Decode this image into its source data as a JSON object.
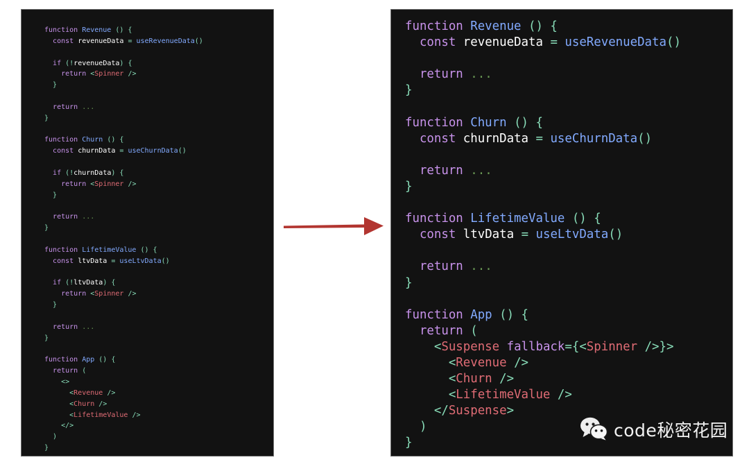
{
  "meta": {
    "background_color": "#ffffff",
    "panel_background": "#121212",
    "panel_border_color": "#6f6f6f",
    "arrow_color": "#b23530"
  },
  "palette": {
    "keyword": "#c792ea",
    "function_name": "#82aaff",
    "variable": "#ffffff",
    "punctuation": "#89ddb9",
    "component": "#e06c75",
    "ellipsis": "#6a9955"
  },
  "panels": {
    "before": {
      "name": "before-code-panel",
      "lines": [
        [
          {
            "t": "function ",
            "c": "kw"
          },
          {
            "t": "Revenue",
            "c": "fn"
          },
          {
            "t": " () {",
            "c": "punct"
          }
        ],
        [
          {
            "t": "  ",
            "c": "plain"
          },
          {
            "t": "const",
            "c": "kw"
          },
          {
            "t": " ",
            "c": "plain"
          },
          {
            "t": "revenueData",
            "c": "var"
          },
          {
            "t": " = ",
            "c": "punct"
          },
          {
            "t": "useRevenueData",
            "c": "fn"
          },
          {
            "t": "()",
            "c": "punct"
          }
        ],
        [],
        [
          {
            "t": "  ",
            "c": "plain"
          },
          {
            "t": "if",
            "c": "kw"
          },
          {
            "t": " (",
            "c": "punct"
          },
          {
            "t": "!",
            "c": "punct"
          },
          {
            "t": "revenueData",
            "c": "var"
          },
          {
            "t": ") {",
            "c": "punct"
          }
        ],
        [
          {
            "t": "    ",
            "c": "plain"
          },
          {
            "t": "return",
            "c": "kw"
          },
          {
            "t": " ",
            "c": "plain"
          },
          {
            "t": "<",
            "c": "punct"
          },
          {
            "t": "Spinner",
            "c": "comp"
          },
          {
            "t": " />",
            "c": "punct"
          }
        ],
        [
          {
            "t": "  }",
            "c": "punct"
          }
        ],
        [],
        [
          {
            "t": "  ",
            "c": "plain"
          },
          {
            "t": "return",
            "c": "kw"
          },
          {
            "t": " ",
            "c": "plain"
          },
          {
            "t": "...",
            "c": "dots"
          }
        ],
        [
          {
            "t": "}",
            "c": "punct"
          }
        ],
        [],
        [
          {
            "t": "function ",
            "c": "kw"
          },
          {
            "t": "Churn",
            "c": "fn"
          },
          {
            "t": " () {",
            "c": "punct"
          }
        ],
        [
          {
            "t": "  ",
            "c": "plain"
          },
          {
            "t": "const",
            "c": "kw"
          },
          {
            "t": " ",
            "c": "plain"
          },
          {
            "t": "churnData",
            "c": "var"
          },
          {
            "t": " = ",
            "c": "punct"
          },
          {
            "t": "useChurnData",
            "c": "fn"
          },
          {
            "t": "()",
            "c": "punct"
          }
        ],
        [],
        [
          {
            "t": "  ",
            "c": "plain"
          },
          {
            "t": "if",
            "c": "kw"
          },
          {
            "t": " (",
            "c": "punct"
          },
          {
            "t": "!",
            "c": "punct"
          },
          {
            "t": "churnData",
            "c": "var"
          },
          {
            "t": ") {",
            "c": "punct"
          }
        ],
        [
          {
            "t": "    ",
            "c": "plain"
          },
          {
            "t": "return",
            "c": "kw"
          },
          {
            "t": " ",
            "c": "plain"
          },
          {
            "t": "<",
            "c": "punct"
          },
          {
            "t": "Spinner",
            "c": "comp"
          },
          {
            "t": " />",
            "c": "punct"
          }
        ],
        [
          {
            "t": "  }",
            "c": "punct"
          }
        ],
        [],
        [
          {
            "t": "  ",
            "c": "plain"
          },
          {
            "t": "return",
            "c": "kw"
          },
          {
            "t": " ",
            "c": "plain"
          },
          {
            "t": "...",
            "c": "dots"
          }
        ],
        [
          {
            "t": "}",
            "c": "punct"
          }
        ],
        [],
        [
          {
            "t": "function ",
            "c": "kw"
          },
          {
            "t": "LifetimeValue",
            "c": "fn"
          },
          {
            "t": " () {",
            "c": "punct"
          }
        ],
        [
          {
            "t": "  ",
            "c": "plain"
          },
          {
            "t": "const",
            "c": "kw"
          },
          {
            "t": " ",
            "c": "plain"
          },
          {
            "t": "ltvData",
            "c": "var"
          },
          {
            "t": " = ",
            "c": "punct"
          },
          {
            "t": "useLtvData",
            "c": "fn"
          },
          {
            "t": "()",
            "c": "punct"
          }
        ],
        [],
        [
          {
            "t": "  ",
            "c": "plain"
          },
          {
            "t": "if",
            "c": "kw"
          },
          {
            "t": " (",
            "c": "punct"
          },
          {
            "t": "!",
            "c": "punct"
          },
          {
            "t": "ltvData",
            "c": "var"
          },
          {
            "t": ") {",
            "c": "punct"
          }
        ],
        [
          {
            "t": "    ",
            "c": "plain"
          },
          {
            "t": "return",
            "c": "kw"
          },
          {
            "t": " ",
            "c": "plain"
          },
          {
            "t": "<",
            "c": "punct"
          },
          {
            "t": "Spinner",
            "c": "comp"
          },
          {
            "t": " />",
            "c": "punct"
          }
        ],
        [
          {
            "t": "  }",
            "c": "punct"
          }
        ],
        [],
        [
          {
            "t": "  ",
            "c": "plain"
          },
          {
            "t": "return",
            "c": "kw"
          },
          {
            "t": " ",
            "c": "plain"
          },
          {
            "t": "...",
            "c": "dots"
          }
        ],
        [
          {
            "t": "}",
            "c": "punct"
          }
        ],
        [],
        [
          {
            "t": "function ",
            "c": "kw"
          },
          {
            "t": "App",
            "c": "fn"
          },
          {
            "t": " () {",
            "c": "punct"
          }
        ],
        [
          {
            "t": "  ",
            "c": "plain"
          },
          {
            "t": "return",
            "c": "kw"
          },
          {
            "t": " (",
            "c": "punct"
          }
        ],
        [
          {
            "t": "    <>",
            "c": "punct"
          }
        ],
        [
          {
            "t": "      <",
            "c": "punct"
          },
          {
            "t": "Revenue",
            "c": "comp"
          },
          {
            "t": " />",
            "c": "punct"
          }
        ],
        [
          {
            "t": "      <",
            "c": "punct"
          },
          {
            "t": "Churn",
            "c": "comp"
          },
          {
            "t": " />",
            "c": "punct"
          }
        ],
        [
          {
            "t": "      <",
            "c": "punct"
          },
          {
            "t": "LifetimeValue",
            "c": "comp"
          },
          {
            "t": " />",
            "c": "punct"
          }
        ],
        [
          {
            "t": "    </>",
            "c": "punct"
          }
        ],
        [
          {
            "t": "  )",
            "c": "punct"
          }
        ],
        [
          {
            "t": "}",
            "c": "punct"
          }
        ]
      ]
    },
    "after": {
      "name": "after-code-panel",
      "lines": [
        [
          {
            "t": "function ",
            "c": "kw"
          },
          {
            "t": "Revenue",
            "c": "fn"
          },
          {
            "t": " () {",
            "c": "punct"
          }
        ],
        [
          {
            "t": "  ",
            "c": "plain"
          },
          {
            "t": "const",
            "c": "kw"
          },
          {
            "t": " ",
            "c": "plain"
          },
          {
            "t": "revenueData",
            "c": "var"
          },
          {
            "t": " = ",
            "c": "punct"
          },
          {
            "t": "useRevenueData",
            "c": "fn"
          },
          {
            "t": "()",
            "c": "punct"
          }
        ],
        [],
        [
          {
            "t": "  ",
            "c": "plain"
          },
          {
            "t": "return",
            "c": "kw"
          },
          {
            "t": " ",
            "c": "plain"
          },
          {
            "t": "...",
            "c": "dots"
          }
        ],
        [
          {
            "t": "}",
            "c": "punct"
          }
        ],
        [],
        [
          {
            "t": "function ",
            "c": "kw"
          },
          {
            "t": "Churn",
            "c": "fn"
          },
          {
            "t": " () {",
            "c": "punct"
          }
        ],
        [
          {
            "t": "  ",
            "c": "plain"
          },
          {
            "t": "const",
            "c": "kw"
          },
          {
            "t": " ",
            "c": "plain"
          },
          {
            "t": "churnData",
            "c": "var"
          },
          {
            "t": " = ",
            "c": "punct"
          },
          {
            "t": "useChurnData",
            "c": "fn"
          },
          {
            "t": "()",
            "c": "punct"
          }
        ],
        [],
        [
          {
            "t": "  ",
            "c": "plain"
          },
          {
            "t": "return",
            "c": "kw"
          },
          {
            "t": " ",
            "c": "plain"
          },
          {
            "t": "...",
            "c": "dots"
          }
        ],
        [
          {
            "t": "}",
            "c": "punct"
          }
        ],
        [],
        [
          {
            "t": "function ",
            "c": "kw"
          },
          {
            "t": "LifetimeValue",
            "c": "fn"
          },
          {
            "t": " () {",
            "c": "punct"
          }
        ],
        [
          {
            "t": "  ",
            "c": "plain"
          },
          {
            "t": "const",
            "c": "kw"
          },
          {
            "t": " ",
            "c": "plain"
          },
          {
            "t": "ltvData",
            "c": "var"
          },
          {
            "t": " = ",
            "c": "punct"
          },
          {
            "t": "useLtvData",
            "c": "fn"
          },
          {
            "t": "()",
            "c": "punct"
          }
        ],
        [],
        [
          {
            "t": "  ",
            "c": "plain"
          },
          {
            "t": "return",
            "c": "kw"
          },
          {
            "t": " ",
            "c": "plain"
          },
          {
            "t": "...",
            "c": "dots"
          }
        ],
        [
          {
            "t": "}",
            "c": "punct"
          }
        ],
        [],
        [
          {
            "t": "function ",
            "c": "kw"
          },
          {
            "t": "App",
            "c": "fn"
          },
          {
            "t": " () {",
            "c": "punct"
          }
        ],
        [
          {
            "t": "  ",
            "c": "plain"
          },
          {
            "t": "return",
            "c": "kw"
          },
          {
            "t": " (",
            "c": "punct"
          }
        ],
        [
          {
            "t": "    <",
            "c": "punct"
          },
          {
            "t": "Suspense",
            "c": "comp"
          },
          {
            "t": " ",
            "c": "plain"
          },
          {
            "t": "fallback",
            "c": "attr"
          },
          {
            "t": "={<",
            "c": "punct"
          },
          {
            "t": "Spinner",
            "c": "comp"
          },
          {
            "t": " />}>",
            "c": "punct"
          }
        ],
        [
          {
            "t": "      <",
            "c": "punct"
          },
          {
            "t": "Revenue",
            "c": "comp"
          },
          {
            "t": " />",
            "c": "punct"
          }
        ],
        [
          {
            "t": "      <",
            "c": "punct"
          },
          {
            "t": "Churn",
            "c": "comp"
          },
          {
            "t": " />",
            "c": "punct"
          }
        ],
        [
          {
            "t": "      <",
            "c": "punct"
          },
          {
            "t": "LifetimeValue",
            "c": "comp"
          },
          {
            "t": " />",
            "c": "punct"
          }
        ],
        [
          {
            "t": "    </",
            "c": "punct"
          },
          {
            "t": "Suspense",
            "c": "comp"
          },
          {
            "t": ">",
            "c": "punct"
          }
        ],
        [
          {
            "t": "  )",
            "c": "punct"
          }
        ],
        [
          {
            "t": "}",
            "c": "punct"
          }
        ]
      ]
    }
  },
  "arrow": {
    "name": "transition-arrow",
    "direction": "right",
    "color": "#b23530"
  },
  "watermark": {
    "icon": "wechat-icon",
    "text": "code秘密花园"
  }
}
